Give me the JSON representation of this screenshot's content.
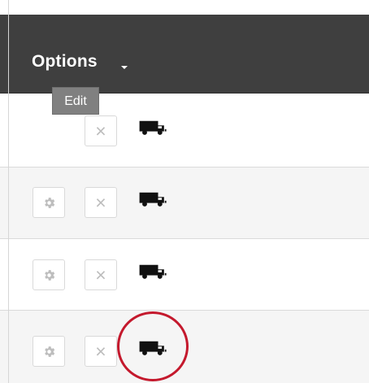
{
  "header": {
    "options_label": "Options"
  },
  "tooltip": {
    "label": "Edit"
  },
  "rows": [
    {
      "show_settings": false,
      "delete_glyph": "×",
      "truck_icon": "truck-icon"
    },
    {
      "show_settings": true,
      "delete_glyph": "×",
      "truck_icon": "truck-icon"
    },
    {
      "show_settings": true,
      "delete_glyph": "×",
      "truck_icon": "truck-icon"
    },
    {
      "show_settings": true,
      "delete_glyph": "×",
      "truck_icon": "truck-icon"
    }
  ],
  "colors": {
    "header_bg": "#3f3f3f",
    "alt_row_bg": "#f5f5f5",
    "highlight": "#c4192d",
    "tooltip_bg": "#808080"
  }
}
